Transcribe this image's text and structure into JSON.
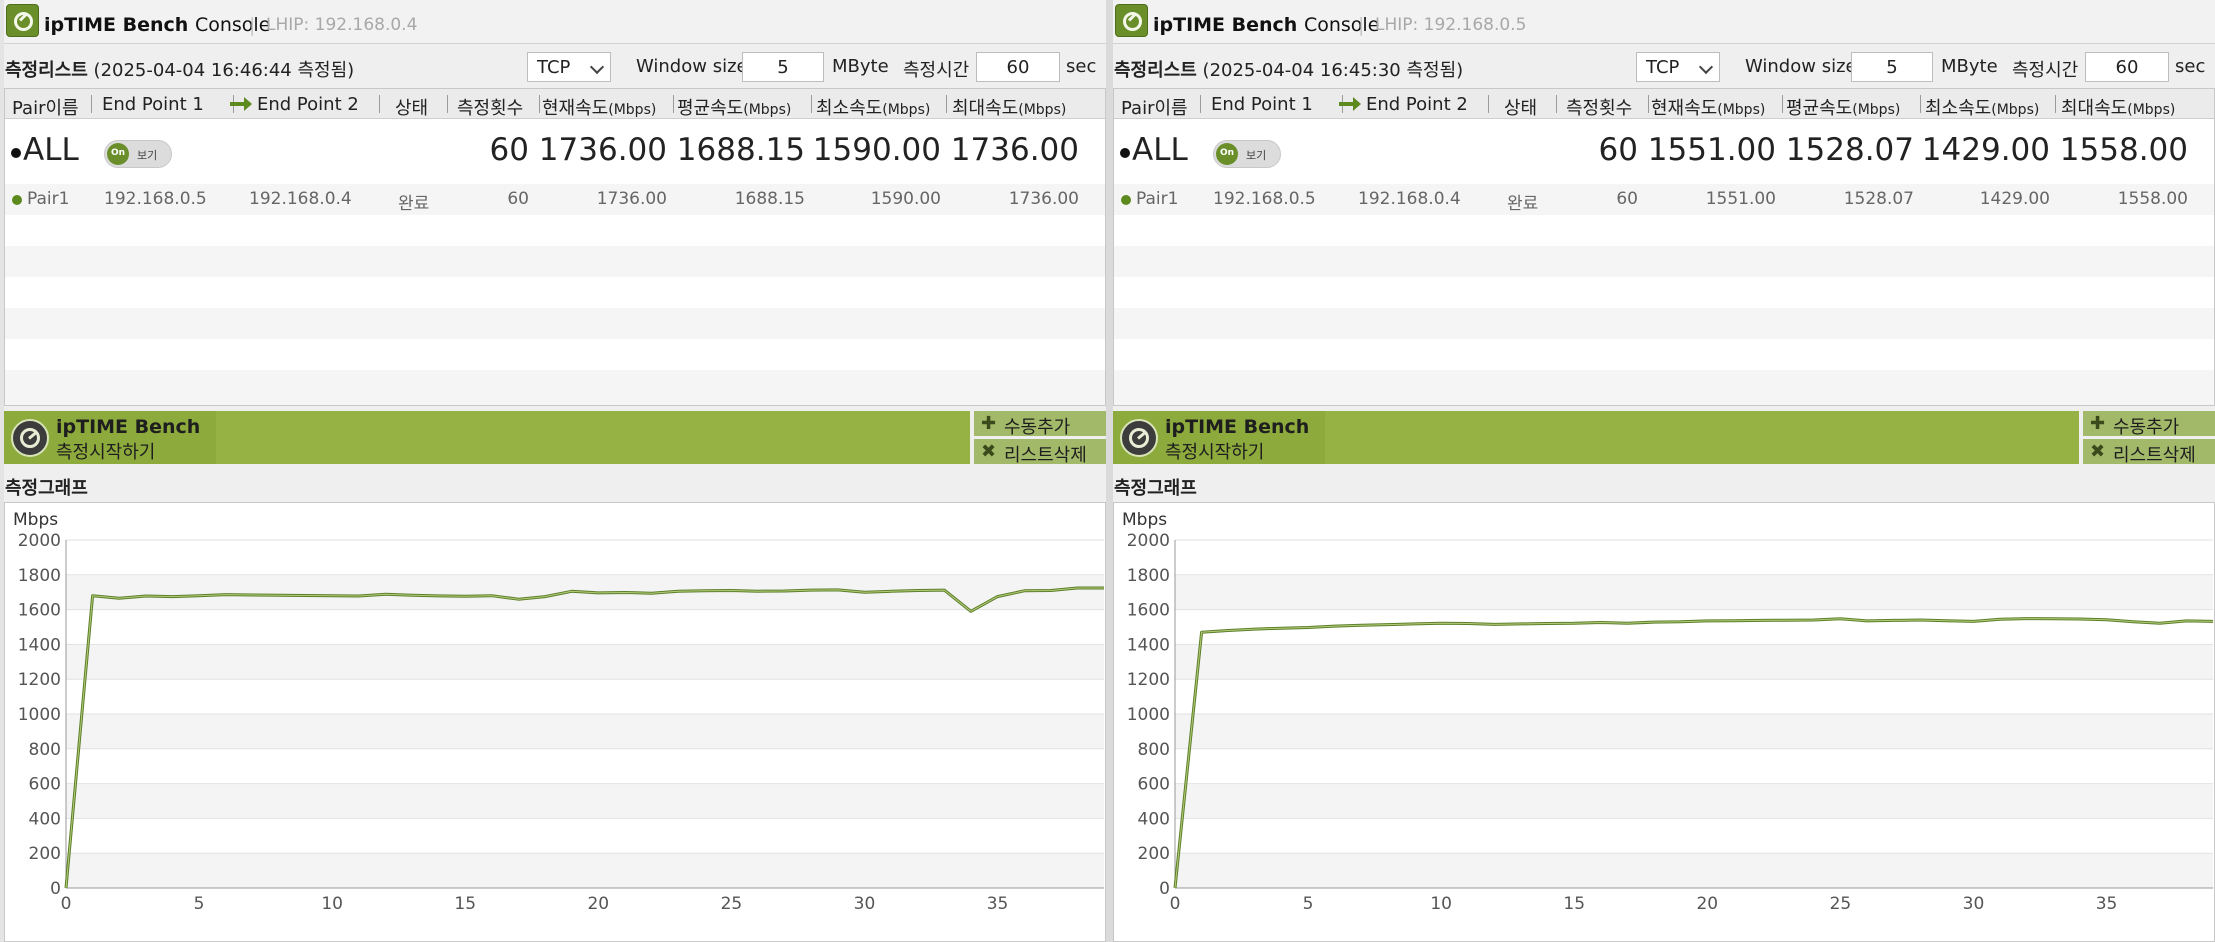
{
  "consoles": [
    {
      "title_bold": "ipTIME Bench",
      "title_thin": "Console",
      "ip": "LHIP: 192.168.0.4",
      "list_title_bold": "측정리스트",
      "list_title_rest": "(2025-04-04 16:46:44 측정됨)",
      "protocol": "TCP",
      "window_size_label": "Window size",
      "window_size": "5",
      "window_unit": "MByte",
      "duration_label": "측정시간",
      "duration": "60",
      "duration_unit": "sec",
      "columns": [
        "Pair이름",
        "End Point 1",
        "End Point 2",
        "상태",
        "측정횟수",
        "현재속도",
        "평균속도",
        "최소속도",
        "최대속도"
      ],
      "col_unit": "(Mbps)",
      "all": {
        "label": "ALL",
        "toggle_on": "On",
        "toggle_label": "보기",
        "count": "60",
        "current": "1736.00",
        "avg": "1688.15",
        "min": "1590.00",
        "max": "1736.00"
      },
      "pair": {
        "name": "Pair1",
        "ep1": "192.168.0.5",
        "ep2": "192.168.0.4",
        "status": "완료",
        "count": "60",
        "current": "1736.00",
        "avg": "1688.15",
        "min": "1590.00",
        "max": "1736.00"
      },
      "action": {
        "title": "ipTIME Bench",
        "sub": "측정시작하기",
        "add_manual": "수동추가",
        "delete_list": "리스트삭제"
      },
      "graph_title": "측정그래프",
      "chart_data": {
        "type": "line",
        "ylabel": "Mbps",
        "ylim": [
          0,
          2000
        ],
        "yticks": [
          "0",
          "200",
          "400",
          "600",
          "800",
          "1000",
          "1200",
          "1400",
          "1600",
          "1800",
          "2000"
        ],
        "xlim": [
          0,
          39
        ],
        "xticks": [
          "0",
          "5",
          "10",
          "15",
          "20",
          "25",
          "30",
          "35"
        ],
        "series": [
          {
            "color": "#5c7f2a",
            "x": [
              0,
              1,
              2,
              3,
              4,
              5,
              6,
              7,
              8,
              9,
              10,
              11,
              12,
              13,
              14,
              15,
              16,
              17,
              18,
              19,
              20,
              21,
              22,
              23,
              24,
              25,
              26,
              27,
              28,
              29,
              30,
              31,
              32,
              33,
              34,
              35,
              36,
              37,
              38,
              39
            ],
            "values": [
              0,
              1680,
              1665,
              1678,
              1675,
              1680,
              1686,
              1684,
              1683,
              1681,
              1680,
              1678,
              1688,
              1682,
              1679,
              1677,
              1680,
              1660,
              1675,
              1705,
              1696,
              1698,
              1694,
              1706,
              1708,
              1710,
              1706,
              1707,
              1712,
              1713,
              1700,
              1705,
              1710,
              1712,
              1590,
              1675,
              1708,
              1710,
              1724,
              1724
            ]
          }
        ],
        "grid": true
      }
    },
    {
      "title_bold": "ipTIME Bench",
      "title_thin": "Console",
      "ip": "LHIP: 192.168.0.5",
      "list_title_bold": "측정리스트",
      "list_title_rest": "(2025-04-04 16:45:30 측정됨)",
      "protocol": "TCP",
      "window_size_label": "Window size",
      "window_size": "5",
      "window_unit": "MByte",
      "duration_label": "측정시간",
      "duration": "60",
      "duration_unit": "sec",
      "columns": [
        "Pair이름",
        "End Point 1",
        "End Point 2",
        "상태",
        "측정횟수",
        "현재속도",
        "평균속도",
        "최소속도",
        "최대속도"
      ],
      "col_unit": "(Mbps)",
      "all": {
        "label": "ALL",
        "toggle_on": "On",
        "toggle_label": "보기",
        "count": "60",
        "current": "1551.00",
        "avg": "1528.07",
        "min": "1429.00",
        "max": "1558.00"
      },
      "pair": {
        "name": "Pair1",
        "ep1": "192.168.0.5",
        "ep2": "192.168.0.4",
        "status": "완료",
        "count": "60",
        "current": "1551.00",
        "avg": "1528.07",
        "min": "1429.00",
        "max": "1558.00"
      },
      "action": {
        "title": "ipTIME Bench",
        "sub": "측정시작하기",
        "add_manual": "수동추가",
        "delete_list": "리스트삭제"
      },
      "graph_title": "측정그래프",
      "chart_data": {
        "type": "line",
        "ylabel": "Mbps",
        "ylim": [
          0,
          2000
        ],
        "yticks": [
          "0",
          "200",
          "400",
          "600",
          "800",
          "1000",
          "1200",
          "1400",
          "1600",
          "1800",
          "2000"
        ],
        "xlim": [
          0,
          39
        ],
        "xticks": [
          "0",
          "5",
          "10",
          "15",
          "20",
          "25",
          "30",
          "35"
        ],
        "series": [
          {
            "color": "#5c7f2a",
            "x": [
              0,
              1,
              2,
              3,
              4,
              5,
              6,
              7,
              8,
              9,
              10,
              11,
              12,
              13,
              14,
              15,
              16,
              17,
              18,
              19,
              20,
              21,
              22,
              23,
              24,
              25,
              26,
              27,
              28,
              29,
              30,
              31,
              32,
              33,
              34,
              35,
              36,
              37,
              38,
              39
            ],
            "values": [
              0,
              1470,
              1480,
              1488,
              1493,
              1497,
              1505,
              1510,
              1514,
              1518,
              1522,
              1520,
              1515,
              1518,
              1520,
              1521,
              1526,
              1522,
              1528,
              1530,
              1535,
              1536,
              1538,
              1539,
              1540,
              1547,
              1535,
              1538,
              1540,
              1536,
              1532,
              1545,
              1548,
              1547,
              1546,
              1542,
              1530,
              1522,
              1535,
              1532
            ]
          }
        ],
        "grid": true
      }
    }
  ]
}
